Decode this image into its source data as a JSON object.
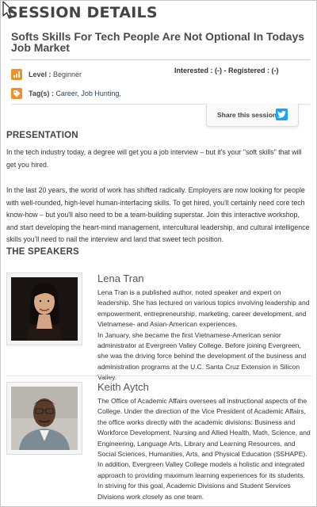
{
  "header": {
    "title": "SESSION DETAILS",
    "session_title": "Softs Skills For Tech People Are Not Optional In Todays Job Market"
  },
  "meta": {
    "level_label": "Level :",
    "level_value": "Beginner",
    "tags_label": "Tag(s) :",
    "tags": [
      "Career,",
      "Job Hunting,"
    ],
    "interest_text": "Interested : (-) - Registered : (-)"
  },
  "share": {
    "label": "Share this session :",
    "icon": "twitter-icon"
  },
  "presentation": {
    "heading": "PRESENTATION",
    "paragraph_1": "In the tech industry today, a degree will get you a job interview – but it's your \"soft skills\" that will get you hired.",
    "paragraph_2": "In the last 20 years, the world of work has shifted radically. Employers are now looking for people with well-rounded, high-level human-interfacing skills. To get hired, you'll certainly need core tech know-how – but you'll also need to be a team-building superstar. Join this interactive workshop, and start developing the heart-mind management, intercultural leadership, and cultural intelligence skills you'll need to nail the interview and land that sweet tech position."
  },
  "speakers": {
    "heading": "THE SPEAKERS",
    "list": [
      {
        "name": "Lena Tran",
        "bio": "Lena Tran is a published author, noted speaker and expert on leadership. She has lectured on various topics involving leadership and empowerment, entrepreneurship, marketing, career development, and Vietnamese- and Asian-American experiences.\nIn January, she became the first Vietnamese-American senior administrator at Evergreen Valley College. Before joining Evergreen, she was the driving force behind the development of the business and administration programs at the U.C. Santa Cruz Extension in Silicon Valley."
      },
      {
        "name": "Keith Aytch",
        "bio": "The Office of Academic Affairs oversees all instructional aspects of the College. Under the direction of the Vice President of Academic Affairs, the office works directly with the academic divisions: Business and Workforce Development, Nursing and Allied Health, Math, Science, and Engineering, Language Arts, Library and Learning Resources, and Social Sciences, Humanities, Arts, and Physical Education (SSHAPE). In addition, Evergreen Valley College models a holistic and integrated approach to providing maximum learning experiences for its students. In striving for this goal, Academic Divisions and Student Services Divisions work closely as one team."
      }
    ]
  },
  "colors": {
    "accent_orange": "#f0902b",
    "twitter_blue": "#1da1f2",
    "link": "#2a3d5c"
  }
}
